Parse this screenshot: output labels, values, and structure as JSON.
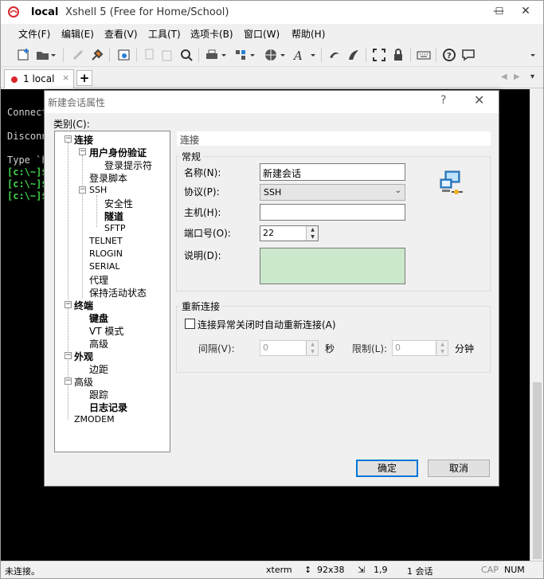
{
  "window": {
    "title_app": "local",
    "title_sub": "Xshell 5 (Free for Home/School)",
    "minimize": "—",
    "maximize": "☐",
    "close": "✕"
  },
  "menu": [
    "文件(F)",
    "编辑(E)",
    "查看(V)",
    "工具(T)",
    "选项卡(B)",
    "窗口(W)",
    "帮助(H)"
  ],
  "tab": {
    "label": "1 local",
    "close": "×",
    "add": "+"
  },
  "terminal": {
    "lines": [
      "Connect",
      "Disconn",
      "Type `h"
    ],
    "prompts": [
      "[c:\\~]$",
      "[c:\\~]$",
      "[c:\\~]$"
    ]
  },
  "status": {
    "left": "未连接。",
    "term": "xterm",
    "size_icon": "↕",
    "size": "92x38",
    "pos_icon": "⇲",
    "pos": "1,9",
    "sessions": "1 会话",
    "caps": "CAP",
    "num": "NUM"
  },
  "dialog": {
    "title": "新建会话属性",
    "help": "?",
    "close": "✕",
    "category_label": "类别(C):",
    "tree": [
      {
        "label": "连接",
        "bold": true
      },
      {
        "label": "用户身份验证",
        "bold": true
      },
      {
        "label": "登录提示符",
        "bold": false
      },
      {
        "label": "登录脚本",
        "bold": false
      },
      {
        "label": "SSH",
        "bold": false
      },
      {
        "label": "安全性",
        "bold": false
      },
      {
        "label": "隧道",
        "bold": true
      },
      {
        "label": "SFTP",
        "bold": false
      },
      {
        "label": "TELNET",
        "bold": false
      },
      {
        "label": "RLOGIN",
        "bold": false
      },
      {
        "label": "SERIAL",
        "bold": false
      },
      {
        "label": "代理",
        "bold": false
      },
      {
        "label": "保持活动状态",
        "bold": false
      },
      {
        "label": "终端",
        "bold": true
      },
      {
        "label": "键盘",
        "bold": true
      },
      {
        "label": "VT 模式",
        "bold": false
      },
      {
        "label": "高级",
        "bold": false
      },
      {
        "label": "外观",
        "bold": true
      },
      {
        "label": "边距",
        "bold": false
      },
      {
        "label": "高级",
        "bold": false
      },
      {
        "label": "跟踪",
        "bold": false
      },
      {
        "label": "日志记录",
        "bold": true
      },
      {
        "label": "ZMODEM",
        "bold": false
      }
    ],
    "header": "连接",
    "general_group": "常规",
    "name_label": "名称(N):",
    "name_value": "新建会话",
    "protocol_label": "协议(P):",
    "protocol_value": "SSH",
    "host_label": "主机(H):",
    "host_value": "",
    "port_label": "端口号(O):",
    "port_value": "22",
    "desc_label": "说明(D):",
    "reconnect_group": "重新连接",
    "reconnect_checkbox": "连接异常关闭时自动重新连接(A)",
    "interval_label": "间隔(V):",
    "interval_value": "0",
    "interval_unit": "秒",
    "limit_label": "限制(L):",
    "limit_value": "0",
    "limit_unit": "分钟",
    "ok": "确定",
    "cancel": "取消"
  },
  "colors": {
    "terminal_bg": "#000000",
    "prompt_green": "#3fd24a",
    "desc_bg": "#cce8cc",
    "tab_dot": "#d9262c",
    "default_btn_border": "#0078d7"
  }
}
